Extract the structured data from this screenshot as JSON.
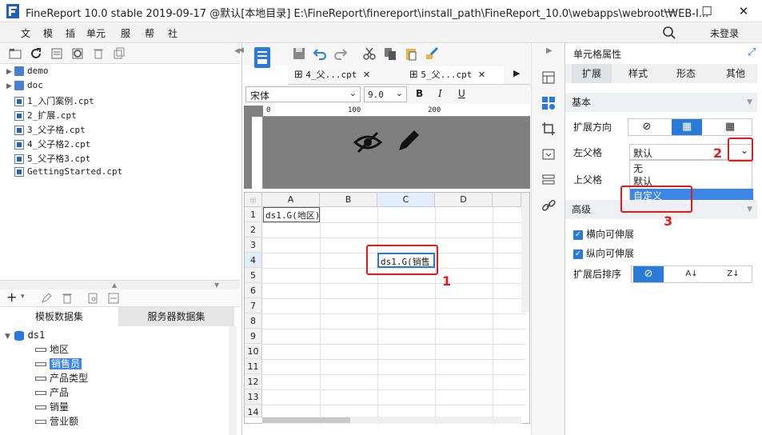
{
  "window": {
    "title": "FineReport 10.0 stable 2019-09-17 @默认[本地目录]    E:\\FineReport\\finereport\\install_path\\FineReport_10.0\\webapps\\webroot\\WEB-I...",
    "minimize": "—",
    "maximize": "☐",
    "close": "✕"
  },
  "menubar": {
    "items": [
      "文",
      "模",
      "插",
      "单元",
      "服",
      "帮",
      "社"
    ],
    "login": "未登录"
  },
  "filetree": {
    "items": [
      {
        "label": "demo",
        "type": "folder"
      },
      {
        "label": "doc",
        "type": "folder"
      },
      {
        "label": "1_入门案例.cpt",
        "type": "cpt"
      },
      {
        "label": "2_扩展.cpt",
        "type": "cpt"
      },
      {
        "label": "3_父子格.cpt",
        "type": "cpt"
      },
      {
        "label": "4_父子格2.cpt",
        "type": "cpt"
      },
      {
        "label": "5_父子格3.cpt",
        "type": "cpt"
      },
      {
        "label": "GettingStarted.cpt",
        "type": "cpt"
      }
    ]
  },
  "dataset": {
    "tabs": [
      "模板数据集",
      "服务器数据集"
    ],
    "root": "ds1",
    "fields": [
      "地区",
      "销售员",
      "产品类型",
      "产品",
      "销量",
      "营业额"
    ],
    "selected_index": 1
  },
  "doctabs": [
    {
      "label": "4_父...cpt"
    },
    {
      "label": "5_父...cpt"
    }
  ],
  "fontbar": {
    "font": "宋体",
    "size": "9.0",
    "bold": "B",
    "italic": "I",
    "underline": "U"
  },
  "ruler": {
    "marks": [
      "0",
      "100",
      "200"
    ]
  },
  "grid": {
    "columns": [
      "A",
      "B",
      "C",
      "D"
    ],
    "rows": [
      "1",
      "2",
      "3",
      "4",
      "5",
      "6",
      "7",
      "8",
      "9",
      "10",
      "11",
      "12",
      "13",
      "14"
    ],
    "cells": [
      {
        "ref": "A1",
        "value": "ds1.G(地区)"
      },
      {
        "ref": "C4",
        "value": "ds1.G(销售"
      }
    ]
  },
  "rightpanel": {
    "header": "单元格属性",
    "tabs": [
      "扩展",
      "样式",
      "形态",
      "其他"
    ],
    "active_tab": 0,
    "section_basic": "基本",
    "expand_dir_label": "扩展方向",
    "left_parent_label": "左父格",
    "left_parent_value": "默认",
    "top_parent_label": "上父格",
    "dropdown_options": [
      "无",
      "默认",
      "自定义"
    ],
    "dropdown_selected": 2,
    "section_advanced": "高级",
    "h_stretch": "横向可伸展",
    "v_stretch": "纵向可伸展",
    "sort_label": "扩展后排序"
  },
  "annotations": {
    "labels": [
      "1",
      "2",
      "3"
    ],
    "color": "#e31b1b"
  },
  "colors": {
    "accent": "#2a7ad8",
    "selected_field": "#3d86e6",
    "canvas_gray": "#808080"
  }
}
